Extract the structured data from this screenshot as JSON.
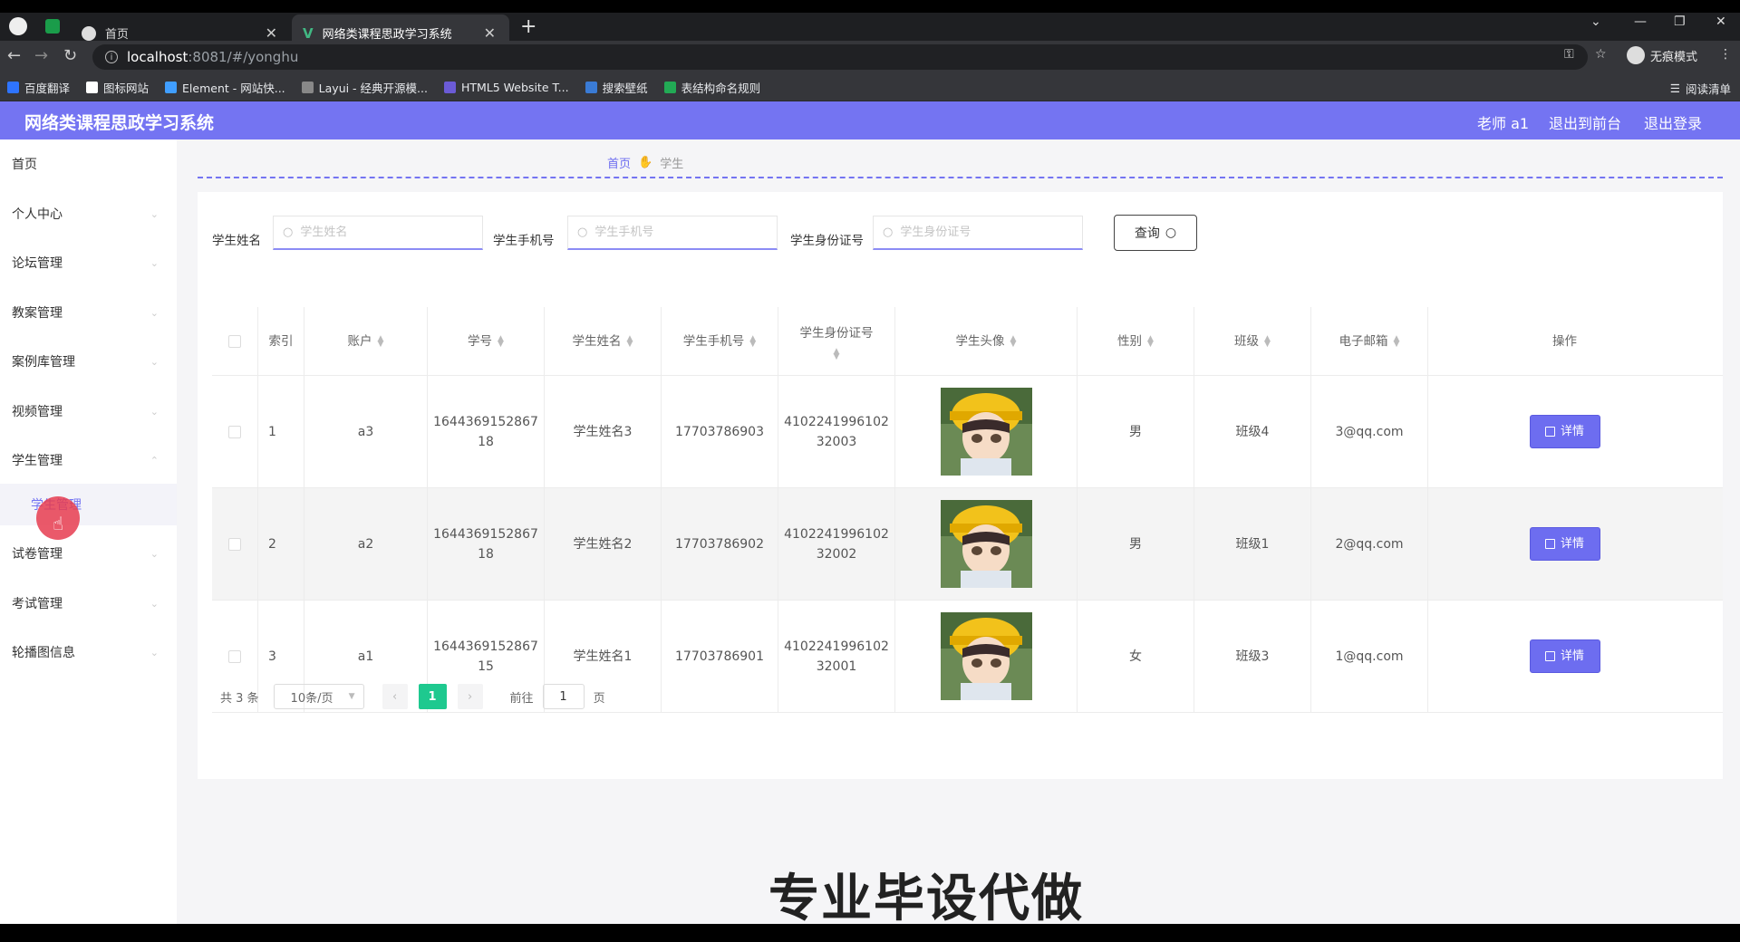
{
  "browser": {
    "tabs": [
      {
        "title": "首页"
      },
      {
        "title": "网络类课程思政学习系统"
      }
    ],
    "url_host": "localhost",
    "url_path": ":8081/#/yonghu",
    "profile_label": "无痕模式",
    "reading_list": "阅读清单",
    "bookmarks": [
      {
        "label": "百度翻译",
        "color": "#2e74ff"
      },
      {
        "label": "图标网站",
        "color": "#ffffff"
      },
      {
        "label": "Element - 网站快...",
        "color": "#409eff"
      },
      {
        "label": "Layui - 经典开源模...",
        "color": "#888888"
      },
      {
        "label": "HTML5 Website T...",
        "color": "#6b5bd6"
      },
      {
        "label": "搜索壁纸",
        "color": "#3a7bd5"
      },
      {
        "label": "表结构命名规则",
        "color": "#22aa55"
      }
    ]
  },
  "header": {
    "title": "网络类课程思政学习系统",
    "user": "老师 a1",
    "to_front": "退出到前台",
    "logout": "退出登录"
  },
  "sidebar": {
    "items": [
      {
        "label": "首页",
        "arrow": false
      },
      {
        "label": "个人中心",
        "arrow": true
      },
      {
        "label": "论坛管理",
        "arrow": true
      },
      {
        "label": "教案管理",
        "arrow": true
      },
      {
        "label": "案例库管理",
        "arrow": true
      },
      {
        "label": "视频管理",
        "arrow": true
      },
      {
        "label": "学生管理",
        "arrow": true
      },
      {
        "label": "试卷管理",
        "arrow": true
      },
      {
        "label": "考试管理",
        "arrow": true
      },
      {
        "label": "轮播图信息",
        "arrow": true
      }
    ],
    "sub_item": "学生管理"
  },
  "breadcrumb": {
    "home": "首页",
    "current": "学生"
  },
  "search": {
    "name_label": "学生姓名",
    "name_placeholder": "学生姓名",
    "phone_label": "学生手机号",
    "phone_placeholder": "学生手机号",
    "id_label": "学生身份证号",
    "id_placeholder": "学生身份证号",
    "query_label": "查询"
  },
  "table": {
    "columns": [
      "索引",
      "账户",
      "学号",
      "学生姓名",
      "学生手机号",
      "学生身份证号",
      "学生头像",
      "性别",
      "班级",
      "电子邮箱",
      "操作"
    ],
    "rows": [
      {
        "index": "1",
        "account": "a3",
        "student_no_1": "1644369152867",
        "student_no_2": "18",
        "name": "学生姓名3",
        "phone": "17703786903",
        "idcard_1": "4102241996102",
        "idcard_2": "32003",
        "gender": "男",
        "class": "班级4",
        "email": "3@qq.com",
        "action": "详情"
      },
      {
        "index": "2",
        "account": "a2",
        "student_no_1": "1644369152867",
        "student_no_2": "18",
        "name": "学生姓名2",
        "phone": "17703786902",
        "idcard_1": "4102241996102",
        "idcard_2": "32002",
        "gender": "男",
        "class": "班级1",
        "email": "2@qq.com",
        "action": "详情"
      },
      {
        "index": "3",
        "account": "a1",
        "student_no_1": "1644369152867",
        "student_no_2": "15",
        "name": "学生姓名1",
        "phone": "17703786901",
        "idcard_1": "4102241996102",
        "idcard_2": "32001",
        "gender": "女",
        "class": "班级3",
        "email": "1@qq.com",
        "action": "详情"
      }
    ]
  },
  "pagination": {
    "total": "共 3 条",
    "page_size": "10条/页",
    "current_page": "1",
    "goto_label": "前往",
    "goto_value": "1",
    "page_unit": "页"
  },
  "watermark": "专业毕设代做",
  "colors": {
    "accent": "#7474f2",
    "button": "#6d6df0",
    "active_page": "#1ec98f"
  }
}
